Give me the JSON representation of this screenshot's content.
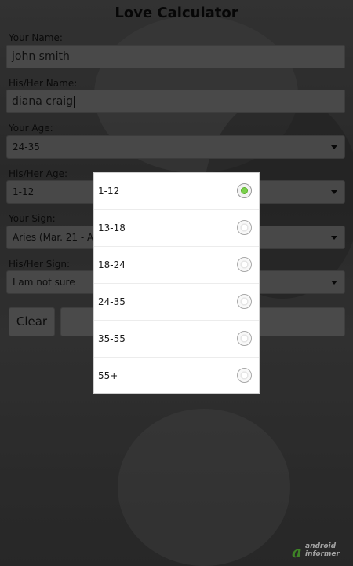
{
  "app": {
    "title": "Love Calculator"
  },
  "form": {
    "your_name_label": "Your Name:",
    "your_name_value": "john smith",
    "their_name_label": "His/Her Name:",
    "their_name_value": "diana craig",
    "your_age_label": "Your Age:",
    "your_age_value": "24-35",
    "their_age_label": "His/Her Age:",
    "their_age_value": "1-12",
    "your_sign_label": "Your Sign:",
    "your_sign_value": "Aries (Mar. 21 - Apr.",
    "their_sign_label": "His/Her Sign:",
    "their_sign_value": "I am not sure"
  },
  "buttons": {
    "clear_label": "Clear"
  },
  "age_dialog": {
    "selected": "1-12",
    "options": [
      "1-12",
      "13-18",
      "18-24",
      "24-35",
      "35-55",
      "55+"
    ]
  },
  "branding": {
    "line1": "android",
    "line2": "informer"
  },
  "colors": {
    "radio_selected": "#79d14a",
    "logo_green": "#5cc238"
  }
}
